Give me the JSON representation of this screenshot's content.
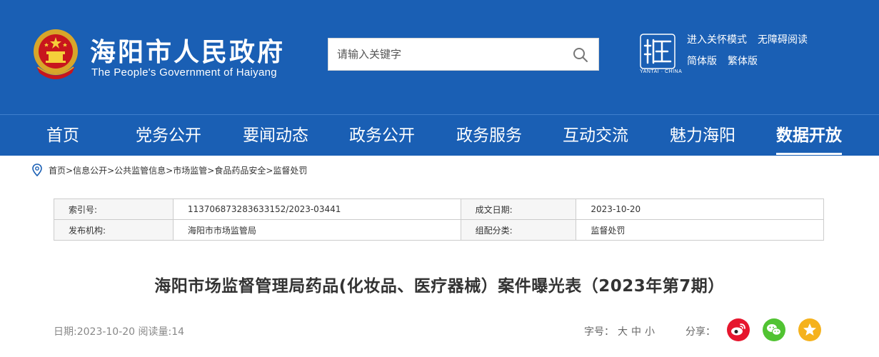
{
  "header": {
    "title": "海阳市人民政府",
    "subtitle": "The People's Government of Haiyang",
    "search": {
      "placeholder": "请输入关键字"
    },
    "yantai_caption": "YANTAI · CHINA",
    "links": {
      "care_mode": "进入关怀模式",
      "accessible": "无障碍阅读",
      "simplified": "简体版",
      "traditional": "繁体版"
    }
  },
  "nav": {
    "items": [
      {
        "label": "首页"
      },
      {
        "label": "党务公开"
      },
      {
        "label": "要闻动态"
      },
      {
        "label": "政务公开"
      },
      {
        "label": "政务服务"
      },
      {
        "label": "互动交流"
      },
      {
        "label": "魅力海阳"
      },
      {
        "label": "数据开放"
      }
    ],
    "active": "数据开放"
  },
  "breadcrumb": {
    "items": [
      "首页",
      "信息公开",
      "公共监管信息",
      "市场监管",
      "食品药品安全",
      "监督处罚"
    ],
    "separator": ">"
  },
  "meta": {
    "index_label": "索引号:",
    "index_value": "113706873283633152/2023-03441",
    "date_label": "成文日期:",
    "date_value": "2023-10-20",
    "issuer_label": "发布机构:",
    "issuer_value": "海阳市市场监管局",
    "category_label": "组配分类:",
    "category_value": "监督处罚"
  },
  "article": {
    "title": "海阳市场监督管理局药品(化妆品、医疗器械）案件曝光表（2023年第7期）",
    "date_read": "日期:2023-10-20 阅读量:14",
    "font_label": "字号：",
    "font_large": "大",
    "font_medium": "中",
    "font_small": "小",
    "share_label": "分享："
  },
  "icons": {
    "search": "search-icon",
    "location": "location-pin-icon",
    "weibo": "weibo-icon",
    "wechat": "wechat-icon",
    "favorite": "star-icon"
  },
  "colors": {
    "brand_blue": "#1a5fb4",
    "weibo": "#e6162d",
    "wechat": "#51c332",
    "favorite": "#f5b21d"
  }
}
